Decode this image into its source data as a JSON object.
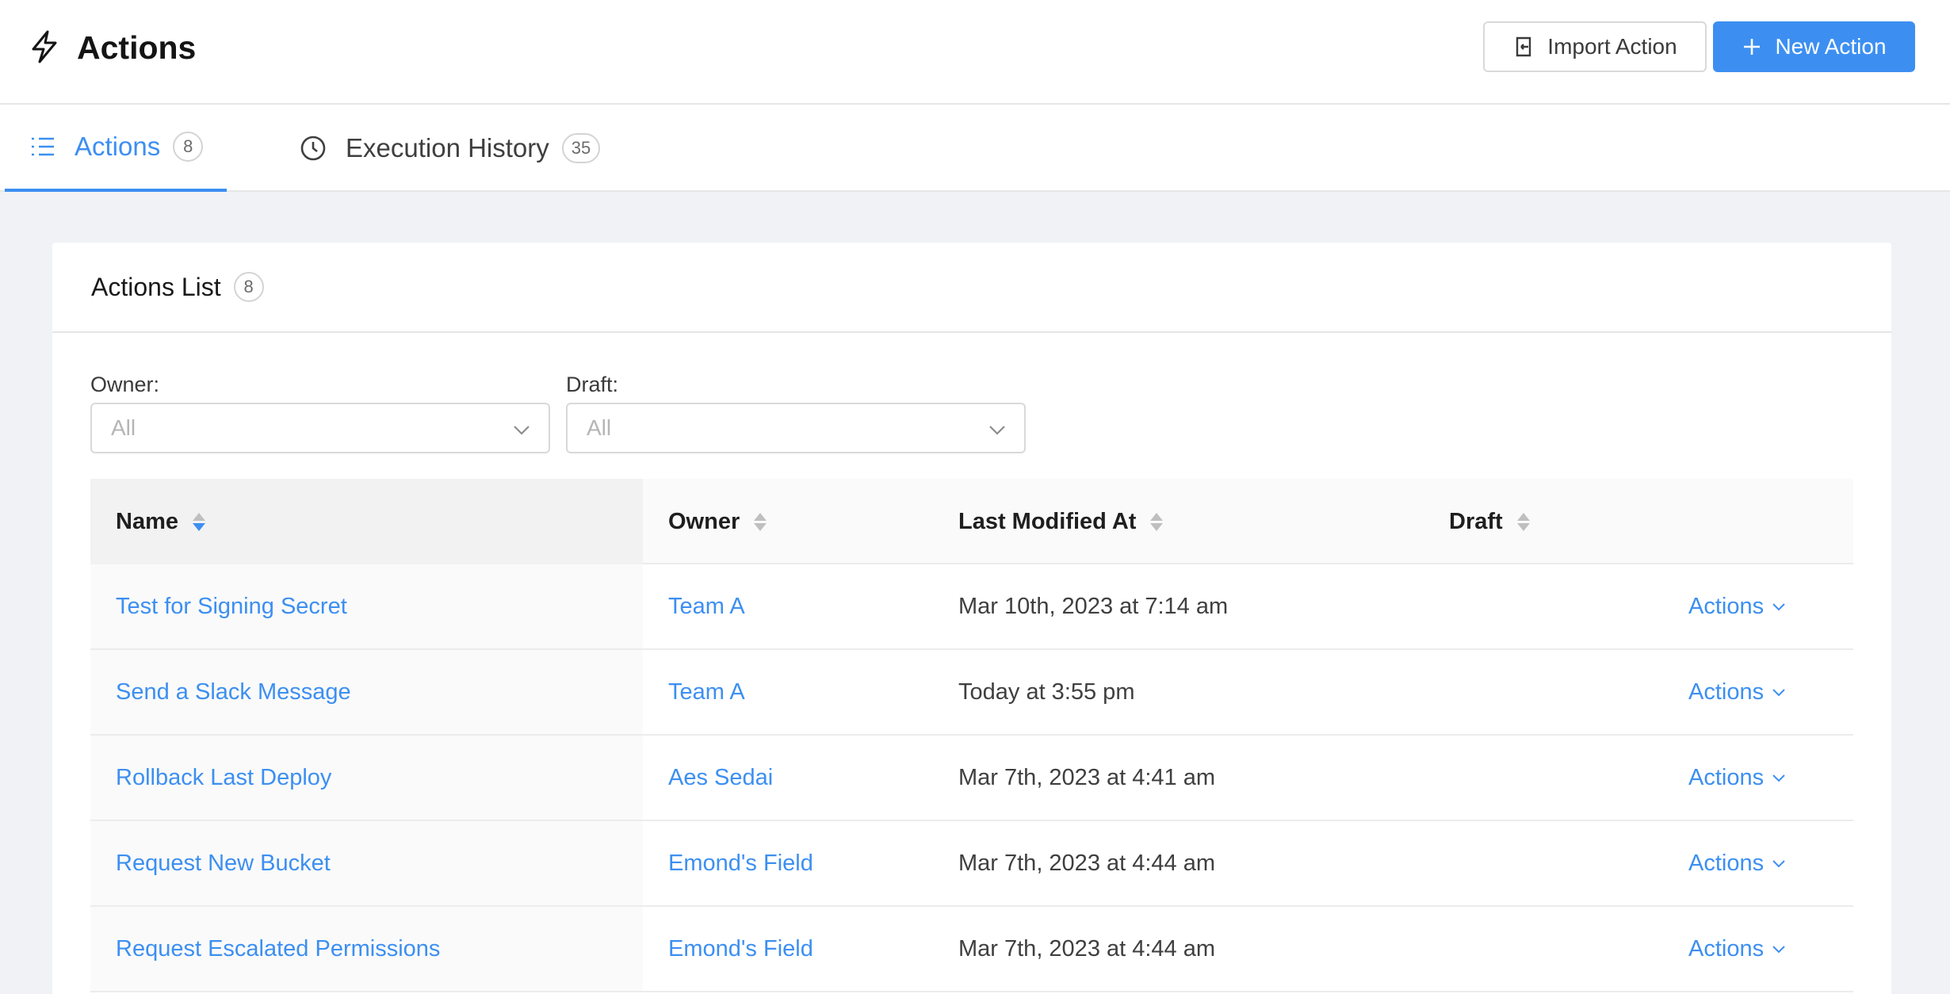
{
  "header": {
    "title": "Actions",
    "import_label": "Import Action",
    "new_label": "New Action"
  },
  "tabs": [
    {
      "label": "Actions",
      "count": "8",
      "active": true
    },
    {
      "label": "Execution History",
      "count": "35",
      "active": false
    }
  ],
  "card": {
    "title": "Actions List",
    "count": "8"
  },
  "filters": {
    "owner_label": "Owner:",
    "owner_value": "All",
    "draft_label": "Draft:",
    "draft_value": "All"
  },
  "table": {
    "columns": [
      "Name",
      "Owner",
      "Last Modified At",
      "Draft"
    ],
    "rows": [
      {
        "name": "Test for Signing Secret",
        "owner": "Team A",
        "modified": "Mar 10th, 2023 at 7:14 am",
        "actions": "Actions"
      },
      {
        "name": "Send a Slack Message",
        "owner": "Team A",
        "modified": "Today at 3:55 pm",
        "actions": "Actions"
      },
      {
        "name": "Rollback Last Deploy",
        "owner": "Aes Sedai",
        "modified": "Mar 7th, 2023 at 4:41 am",
        "actions": "Actions"
      },
      {
        "name": "Request New Bucket",
        "owner": "Emond's Field",
        "modified": "Mar 7th, 2023 at 4:44 am",
        "actions": "Actions"
      },
      {
        "name": "Request Escalated Permissions",
        "owner": "Emond's Field",
        "modified": "Mar 7th, 2023 at 4:44 am",
        "actions": "Actions"
      }
    ]
  },
  "colors": {
    "accent": "#3c8ff1",
    "page_bg": "#f0f2f5"
  },
  "icons": {
    "app": "lightning-icon",
    "import": "import-icon",
    "new": "plus-icon",
    "tab_actions": "list-icon",
    "tab_history": "clock-icon",
    "select": "chevron-down-icon",
    "sort": "sort-icon"
  }
}
